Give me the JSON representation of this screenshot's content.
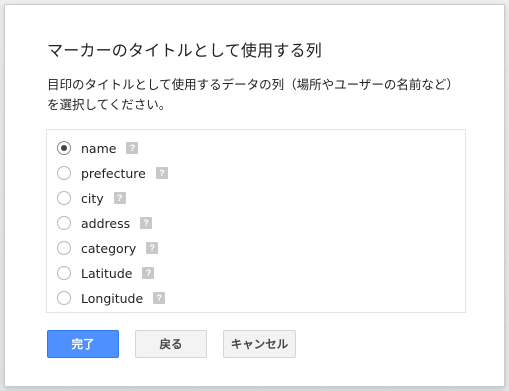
{
  "dialog": {
    "title": "マーカーのタイトルとして使用する列",
    "description": "目印のタイトルとして使用するデータの列（場所やユーザーの名前など）を選択してください。",
    "options": [
      {
        "label": "name",
        "checked": true
      },
      {
        "label": "prefecture",
        "checked": false
      },
      {
        "label": "city",
        "checked": false
      },
      {
        "label": "address",
        "checked": false
      },
      {
        "label": "category",
        "checked": false
      },
      {
        "label": "Latitude",
        "checked": false
      },
      {
        "label": "Longitude",
        "checked": false
      }
    ],
    "help_glyph": "?",
    "buttons": {
      "done": "完了",
      "back": "戻る",
      "cancel": "キャンセル"
    }
  },
  "colors": {
    "primary_button": "#4d90fe",
    "help_badge": "#c8c8c8"
  }
}
